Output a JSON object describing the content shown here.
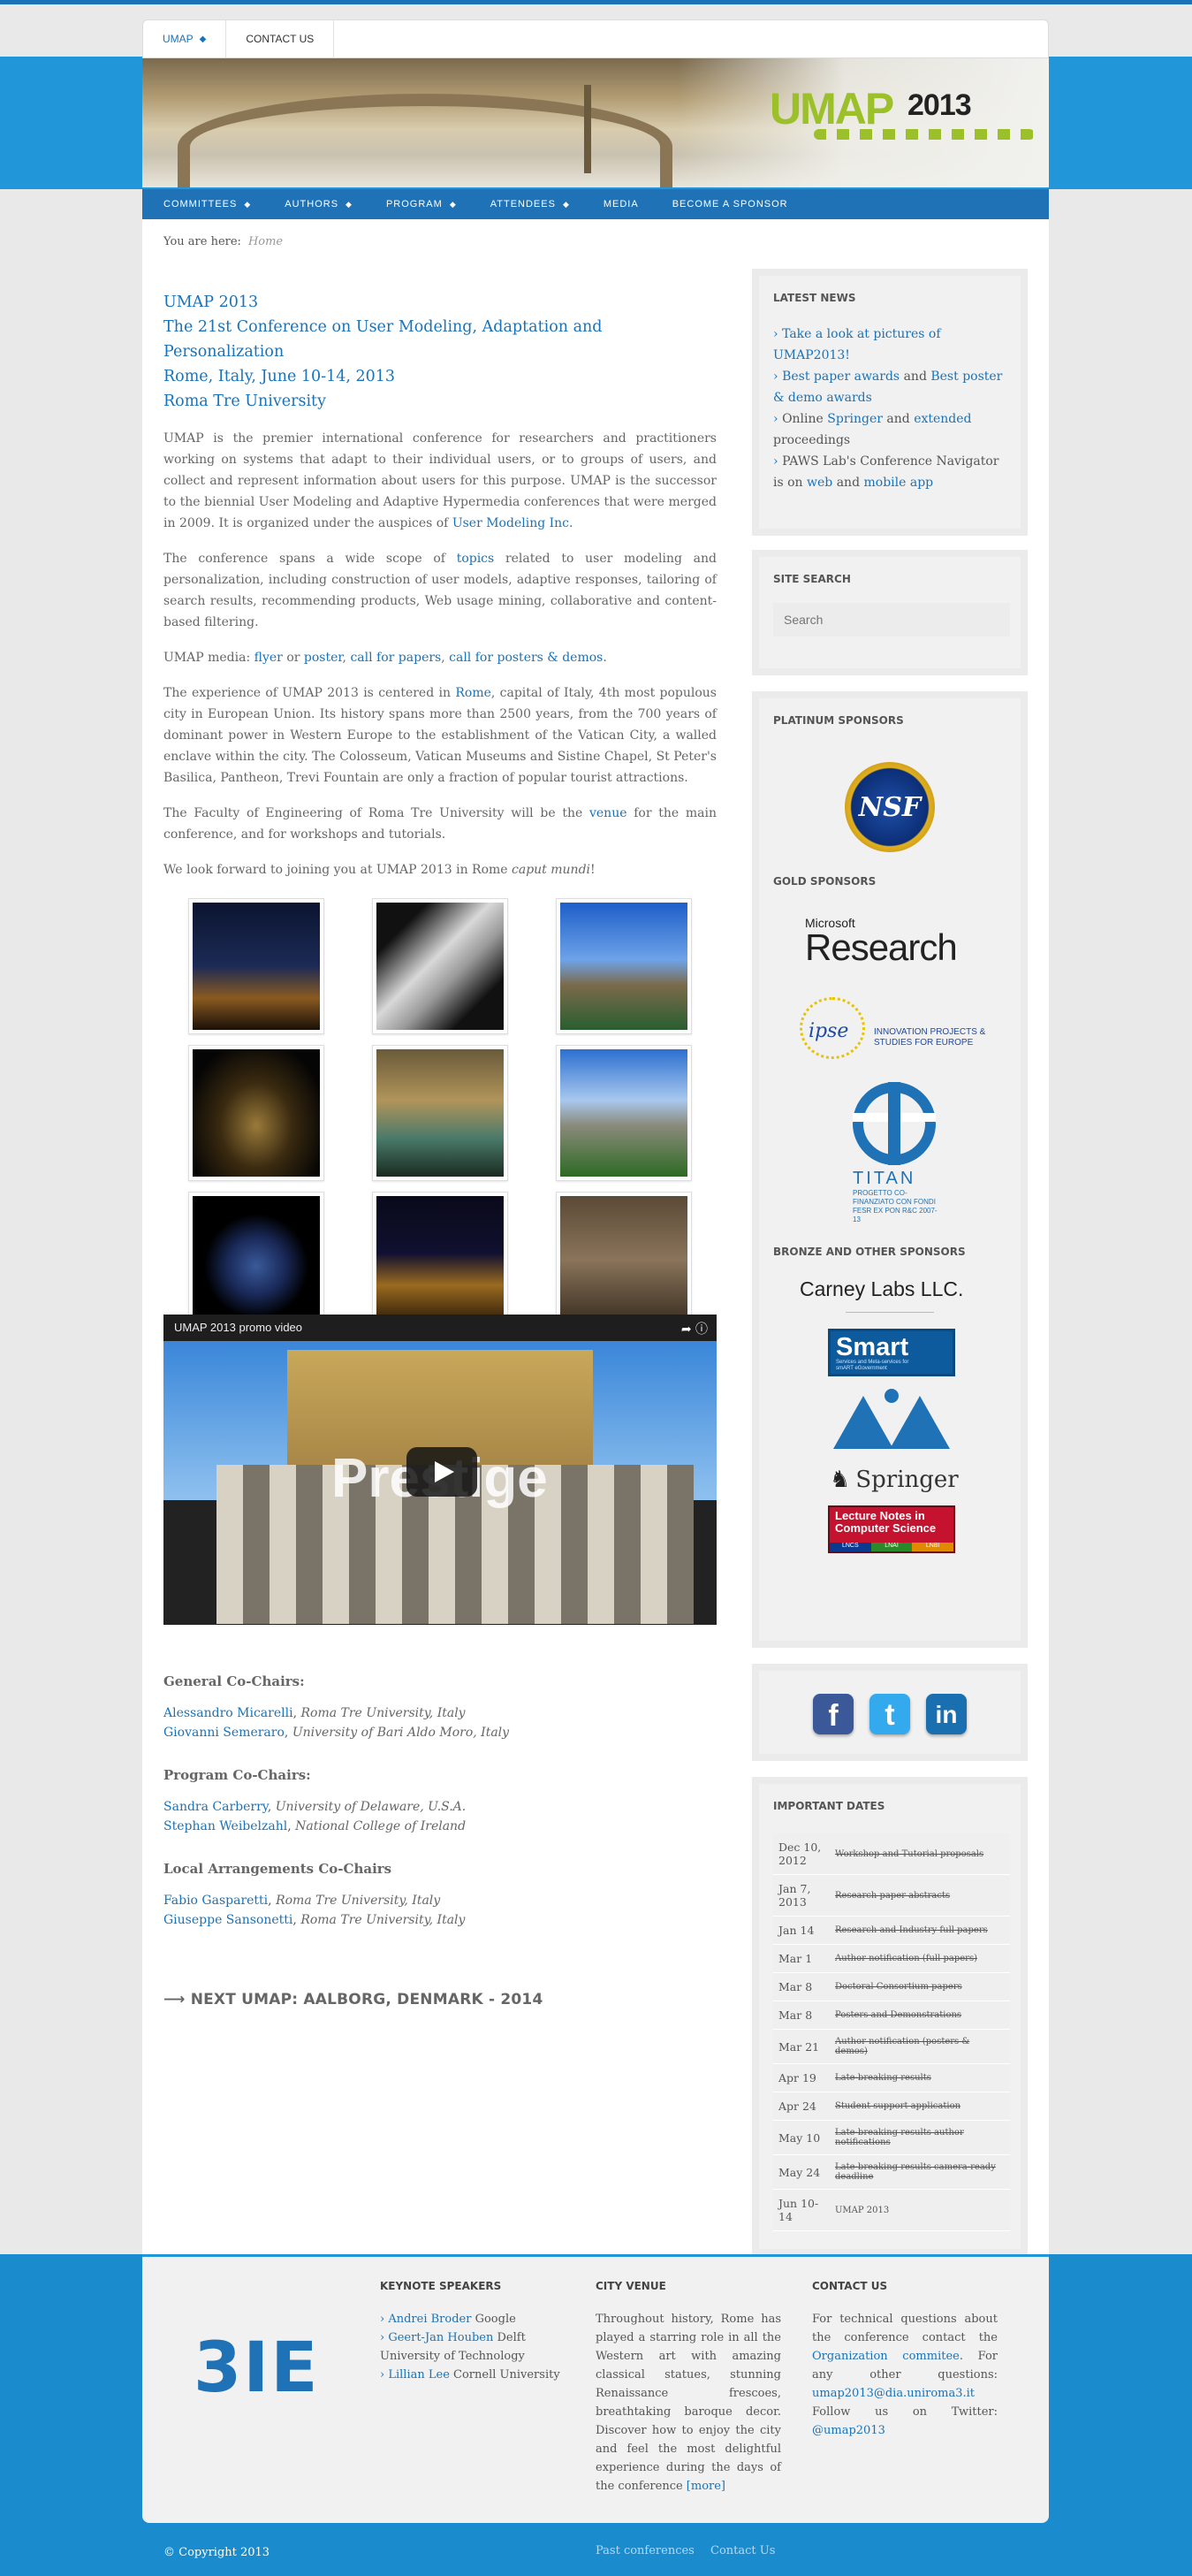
{
  "topnav": {
    "items": [
      {
        "label": "UMAP",
        "active": true
      },
      {
        "label": "CONTACT US",
        "active": false
      }
    ]
  },
  "banner": {
    "logo_text": "UMAP",
    "logo_year": "2013"
  },
  "mainnav": {
    "items": [
      "COMMITTEES",
      "AUTHORS",
      "PROGRAM",
      "ATTENDEES",
      "MEDIA",
      "BECOME A SPONSOR"
    ]
  },
  "breadcrumb": {
    "label": "You are here:",
    "current": "Home"
  },
  "main": {
    "title_lines": [
      "UMAP 2013",
      "The 21st Conference on User Modeling, Adaptation and Personalization",
      "Rome, Italy, June 10-14, 2013",
      "Roma Tre University"
    ],
    "p1_text": "UMAP is the premier international conference for researchers and practitioners working on systems that adapt to their individual users, or to groups of users, and collect and represent information about users for this purpose. UMAP is the successor to the biennial User Modeling and Adaptive Hypermedia conferences that were merged in 2009. It is organized under the auspices of ",
    "p1_link": "User Modeling Inc.",
    "p2_pre": "The conference spans a wide scope of ",
    "p2_link": "topics",
    "p2_post": " related to user modeling and personalization, including construction of user models, adaptive responses, tailoring of search results, recommending products, Web usage mining, collaborative and content-based filtering.",
    "p3_pre": "UMAP media: ",
    "p3_links": [
      "flyer",
      "poster",
      "call for papers",
      "call for posters & demos"
    ],
    "p3_or": " or ",
    "p3_comma": ", ",
    "p3_end": ".",
    "p4_pre": "The experience of UMAP 2013 is centered in ",
    "p4_link": "Rome",
    "p4_post": ", capital of Italy, 4th most populous city in European Union. Its history spans more than 2500 years, from the 700 years of dominant power in Western Europe to the establishment of the Vatican City, a walled enclave within the city. The Colosseum, Vatican Museums and Sistine Chapel, St Peter's Basilica, Pantheon, Trevi Fountain are only a fraction of popular tourist attractions.",
    "p5_pre": "The Faculty of Engineering of Roma Tre University will be the ",
    "p5_link": "venue",
    "p5_post": " for the main conference, and for workshops and tutorials.",
    "p6_pre": "We look forward to joining you at UMAP 2013 in Rome ",
    "p6_em": "caput mundi",
    "p6_end": "!",
    "video_title": "UMAP 2013 promo video",
    "video_overlay": "Prestige",
    "chairs": {
      "general_heading": "General Co-Chairs:",
      "general": [
        {
          "name": "Alessandro Micarelli",
          "aff": "Roma Tre University, Italy"
        },
        {
          "name": "Giovanni Semeraro",
          "aff": "University of Bari Aldo Moro, Italy"
        }
      ],
      "program_heading": "Program Co-Chairs:",
      "program": [
        {
          "name": "Sandra Carberry",
          "aff": "University of Delaware, U.S.A."
        },
        {
          "name": "Stephan Weibelzahl",
          "aff": "National College of Ireland"
        }
      ],
      "local_heading": "Local Arrangements Co-Chairs",
      "local": [
        {
          "name": "Fabio Gasparetti",
          "aff": "Roma Tre University, Italy"
        },
        {
          "name": "Giuseppe Sansonetti",
          "aff": "Roma Tre University, Italy"
        }
      ]
    },
    "next_umap": "⟶ NEXT UMAP: AALBORG, DENMARK - 2014"
  },
  "sidebar": {
    "news_heading": "LATEST NEWS",
    "news": {
      "n1_link": "Take a look at pictures of UMAP2013!",
      "n2_link1": "Best paper awards",
      "n2_and": " and ",
      "n2_link2": "Best poster & demo awards",
      "n3_pre": "Online ",
      "n3_link1": "Springer",
      "n3_and": " and ",
      "n3_link2": "extended",
      "n3_post": " proceedings",
      "n4_pre": "PAWS Lab's Conference Navigator is on ",
      "n4_link1": "web",
      "n4_and": " and ",
      "n4_link2": "mobile app"
    },
    "search_heading": "SITE SEARCH",
    "search_placeholder": "Search",
    "platinum_heading": "PLATINUM SPONSORS",
    "platinum_logo": "NSF",
    "gold_heading": "GOLD SPONSORS",
    "gold": {
      "ms_small": "Microsoft",
      "ms_big": "Research",
      "ipse_text": "INNOVATION PROJECTS & STUDIES FOR EUROPE",
      "titan_name": "TITAN",
      "titan_sub": "PROGETTO CO-FINANZIATO CON FONDI FESR EX PON R&C 2007-13"
    },
    "bronze_heading": "BRONZE AND OTHER SPONSORS",
    "bronze": {
      "carney": "Carney Labs LLC.",
      "smart": "Smart",
      "smart_sub": "Services and Meta-services for smART eGovernment",
      "springer": "Springer",
      "lncs": "Lecture Notes in Computer Science",
      "lncs_tags": [
        "LNCS",
        "LNAI",
        "LNBI"
      ]
    },
    "social": [
      "f",
      "t",
      "in"
    ],
    "dates_heading": "IMPORTANT DATES",
    "dates": [
      {
        "date": "Dec 10, 2012",
        "event": "Workshop and Tutorial proposals",
        "past": true
      },
      {
        "date": "Jan 7, 2013",
        "event": "Research paper abstracts",
        "past": true
      },
      {
        "date": "Jan 14",
        "event": "Research and Industry full papers",
        "past": true
      },
      {
        "date": "Mar 1",
        "event": "Author notification (full papers)",
        "past": true
      },
      {
        "date": "Mar 8",
        "event": "Doctoral Consortium papers",
        "past": true
      },
      {
        "date": "Mar 8",
        "event": "Posters and Demonstrations",
        "past": true
      },
      {
        "date": "Mar 21",
        "event": "Author notification (posters & demos)",
        "past": true
      },
      {
        "date": "Apr 19",
        "event": "Late-breaking results",
        "past": true
      },
      {
        "date": "Apr 24",
        "event": "Student support application",
        "past": true
      },
      {
        "date": "May 10",
        "event": "Late-breaking results author notifications",
        "past": true
      },
      {
        "date": "May 24",
        "event": "Late-breaking results camera-ready deadline",
        "past": true
      },
      {
        "date": "Jun 10-14",
        "event": "UMAP 2013",
        "past": false
      }
    ]
  },
  "footer": {
    "logo_text": "3IE",
    "keynote_heading": "KEYNOTE SPEAKERS",
    "keynote": [
      {
        "name": "Andrei Broder",
        "aff": "Google"
      },
      {
        "name": "Geert-Jan Houben",
        "aff": "Delft University of Technology"
      },
      {
        "name": "Lillian Lee",
        "aff": "Cornell University"
      }
    ],
    "venue_heading": "CITY VENUE",
    "venue_text": "Throughout history, Rome has played a starring role in all the Western art with amazing classical statues, stunning Renaissance frescoes, breathtaking baroque decor. Discover how to enjoy the city and feel the most delightful experience during the days of the conference ",
    "venue_more": "[more]",
    "contact_heading": "CONTACT US",
    "contact_pre": "For technical questions about the conference contact the ",
    "contact_link": "Organization commitee",
    "contact_mid": ". For any other questions: ",
    "contact_email": "umap2013@dia.uniroma3.it",
    "contact_follow": " Follow us on Twitter: ",
    "contact_twitter": "@umap2013",
    "copyright": "© Copyright 2013",
    "links": [
      "Past conferences",
      "Contact Us"
    ]
  }
}
